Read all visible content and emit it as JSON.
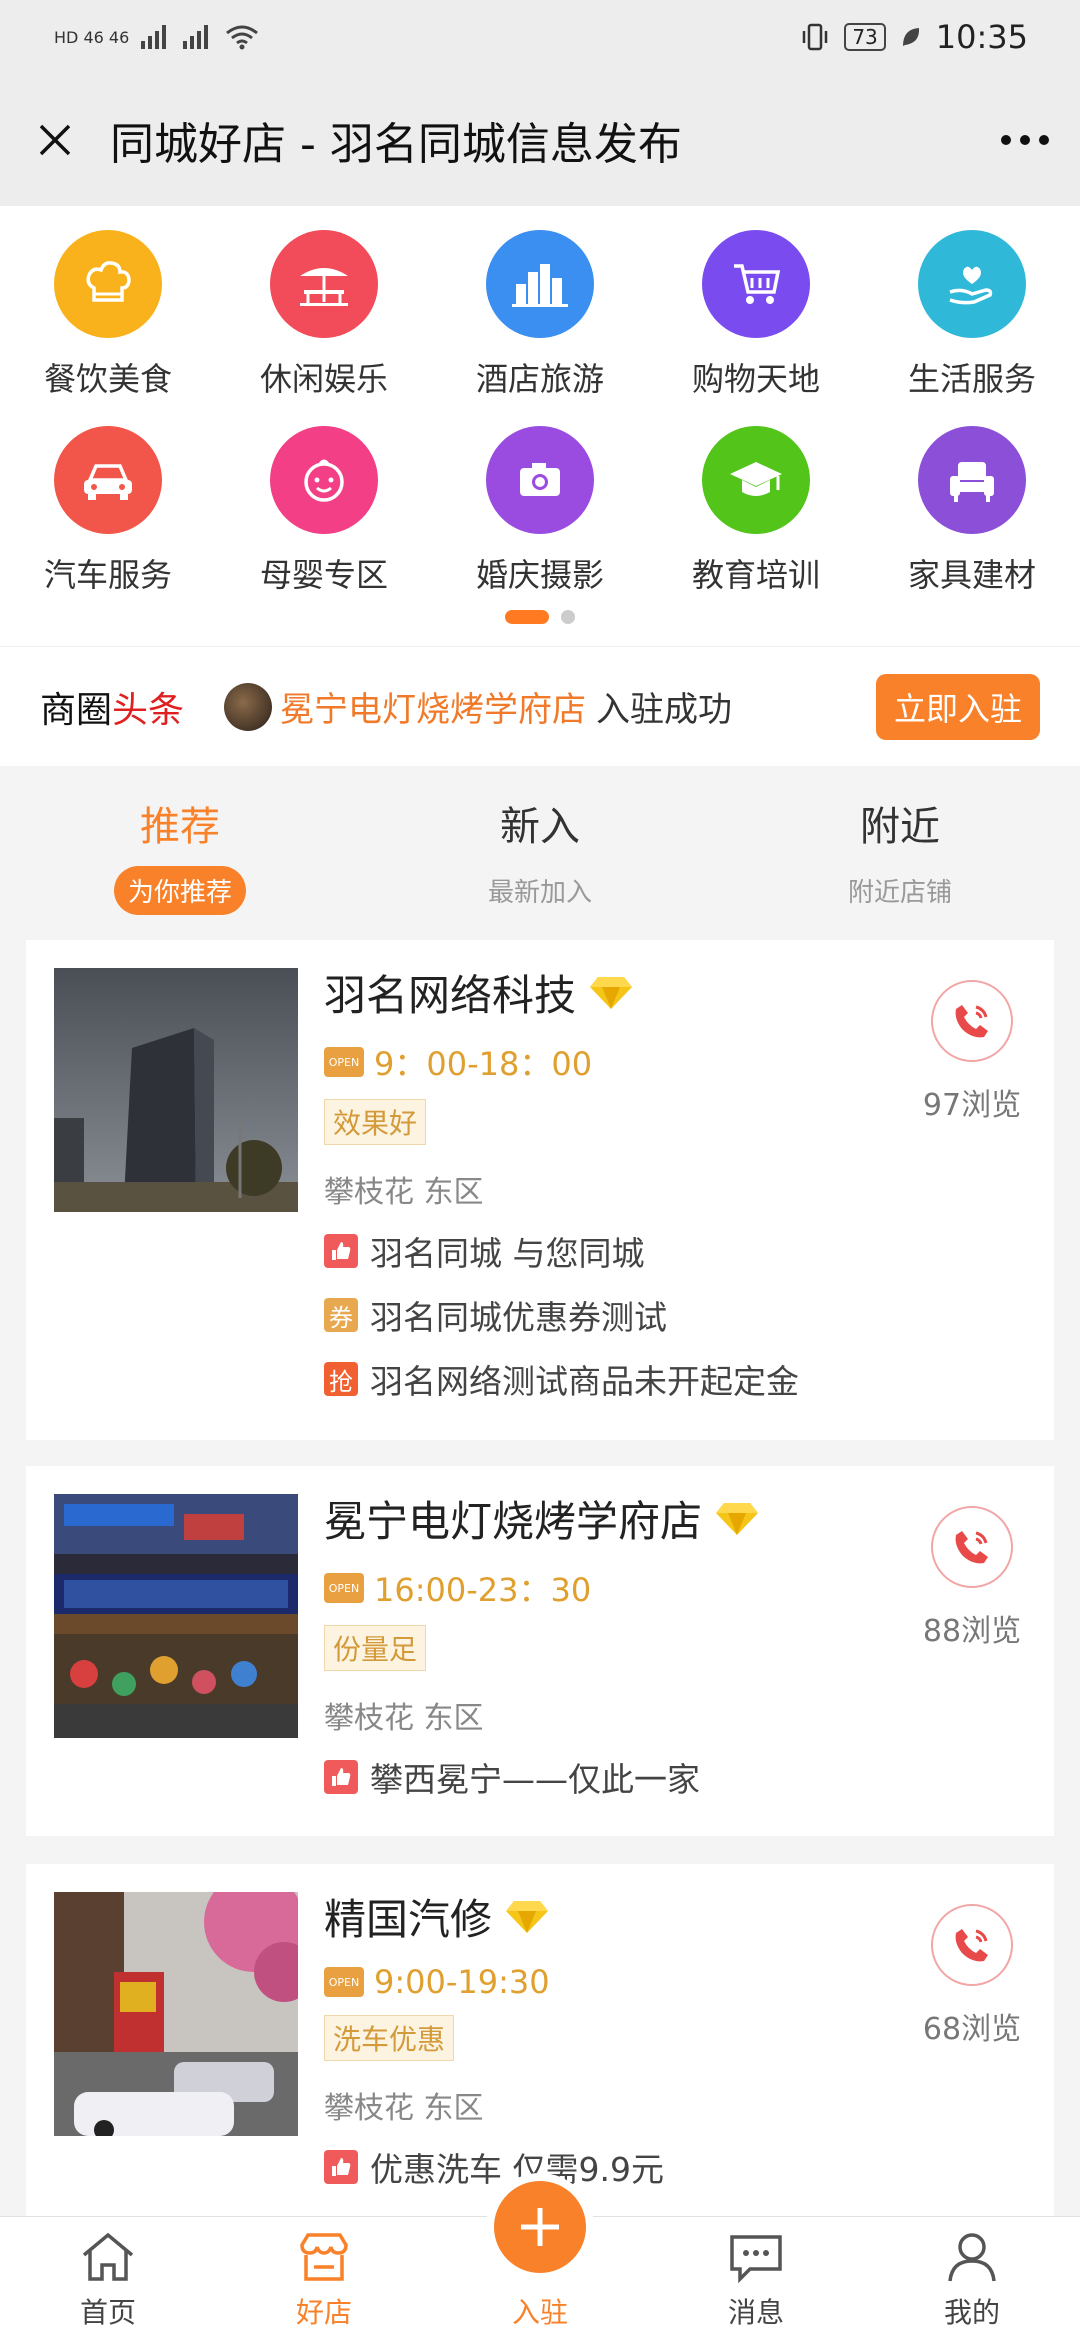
{
  "status_bar": {
    "left": "HD 46 46",
    "battery": "73",
    "time": "10:35"
  },
  "header": {
    "title": "同城好店 - 羽名同城信息发布"
  },
  "categories": [
    {
      "label": "餐饮美食",
      "icon": "chef-hat-icon",
      "color": "#f9b21c"
    },
    {
      "label": "休闲娱乐",
      "icon": "umbrella-table-icon",
      "color": "#f24b5a"
    },
    {
      "label": "酒店旅游",
      "icon": "city-buildings-icon",
      "color": "#3a8ff0"
    },
    {
      "label": "购物天地",
      "icon": "shopping-cart-icon",
      "color": "#7a4cf0"
    },
    {
      "label": "生活服务",
      "icon": "hand-heart-icon",
      "color": "#30b8d8"
    },
    {
      "label": "汽车服务",
      "icon": "car-icon",
      "color": "#f2554a"
    },
    {
      "label": "母婴专区",
      "icon": "baby-face-icon",
      "color": "#f23f86"
    },
    {
      "label": "婚庆摄影",
      "icon": "camera-icon",
      "color": "#9a4ce0"
    },
    {
      "label": "教育培训",
      "icon": "graduation-cap-icon",
      "color": "#52c41a"
    },
    {
      "label": "家具建材",
      "icon": "armchair-icon",
      "color": "#8c4fd8"
    }
  ],
  "headline": {
    "title_a": "商圈",
    "title_b": "头条",
    "shop": "冕宁电灯烧烤学府店",
    "status": "入驻成功",
    "join_label": "立即入驻"
  },
  "tabs": [
    {
      "title": "推荐",
      "sub": "为你推荐",
      "active": true
    },
    {
      "title": "新入",
      "sub": "最新加入",
      "active": false
    },
    {
      "title": "附近",
      "sub": "附近店铺",
      "active": false
    }
  ],
  "shops": [
    {
      "name": "羽名网络科技",
      "hours": "9：00-18：00",
      "tag": "效果好",
      "area": "攀枝花 东区",
      "views": "97浏览",
      "promos": [
        {
          "type": "thumb",
          "badge": "",
          "text": "羽名同城 与您同城"
        },
        {
          "type": "coupon",
          "badge": "券",
          "text": "羽名同城优惠券测试"
        },
        {
          "type": "grab",
          "badge": "抢",
          "text": "羽名网络测试商品未开起定金"
        }
      ]
    },
    {
      "name": "冕宁电灯烧烤学府店",
      "hours": "16:00-23：30",
      "tag": "份量足",
      "area": "攀枝花 东区",
      "views": "88浏览",
      "promos": [
        {
          "type": "thumb",
          "badge": "",
          "text": "攀西冕宁——仅此一家"
        }
      ]
    },
    {
      "name": "精国汽修",
      "hours": "9:00-19:30",
      "tag": "洗车优惠",
      "area": "攀枝花 东区",
      "views": "68浏览",
      "promos": [
        {
          "type": "thumb",
          "badge": "",
          "text": "优惠洗车 仅需9.9元"
        }
      ]
    }
  ],
  "open_sign": "OPEN",
  "bottom_nav": [
    {
      "label": "首页",
      "icon": "home-icon"
    },
    {
      "label": "好店",
      "icon": "shop-icon",
      "active": true
    },
    {
      "label": "入驻",
      "icon": "plus-icon"
    },
    {
      "label": "消息",
      "icon": "message-icon"
    },
    {
      "label": "我的",
      "icon": "user-icon"
    }
  ]
}
